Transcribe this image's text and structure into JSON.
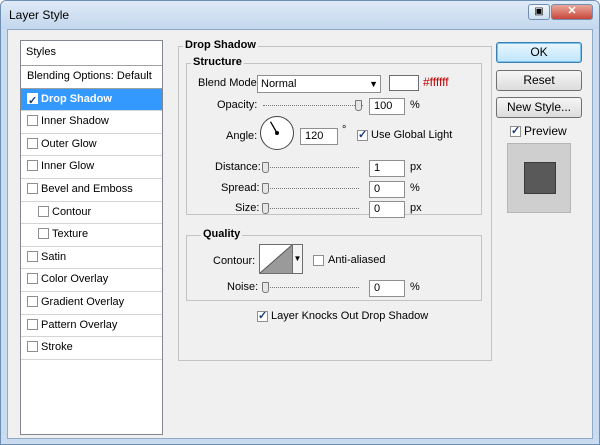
{
  "window": {
    "title": "Layer Style",
    "close_glyph": "✕"
  },
  "styles_panel": {
    "header": "Styles",
    "items": [
      {
        "label": "Blending Options: Default",
        "checkbox": false,
        "checked": false,
        "selected": false
      },
      {
        "label": "Drop Shadow",
        "checkbox": true,
        "checked": true,
        "selected": true
      },
      {
        "label": "Inner Shadow",
        "checkbox": true,
        "checked": false,
        "selected": false
      },
      {
        "label": "Outer Glow",
        "checkbox": true,
        "checked": false,
        "selected": false
      },
      {
        "label": "Inner Glow",
        "checkbox": true,
        "checked": false,
        "selected": false
      },
      {
        "label": "Bevel and Emboss",
        "checkbox": true,
        "checked": false,
        "selected": false
      },
      {
        "label": "Contour",
        "checkbox": true,
        "checked": false,
        "selected": false,
        "sub": true
      },
      {
        "label": "Texture",
        "checkbox": true,
        "checked": false,
        "selected": false,
        "sub": true
      },
      {
        "label": "Satin",
        "checkbox": true,
        "checked": false,
        "selected": false
      },
      {
        "label": "Color Overlay",
        "checkbox": true,
        "checked": false,
        "selected": false
      },
      {
        "label": "Gradient Overlay",
        "checkbox": true,
        "checked": false,
        "selected": false
      },
      {
        "label": "Pattern Overlay",
        "checkbox": true,
        "checked": false,
        "selected": false
      },
      {
        "label": "Stroke",
        "checkbox": true,
        "checked": false,
        "selected": false
      }
    ]
  },
  "drop_shadow": {
    "title": "Drop Shadow",
    "structure": {
      "title": "Structure",
      "blend_mode_label": "Blend Mode:",
      "blend_mode_value": "Normal",
      "color_hex": "#ffffff",
      "color": "#ffffff",
      "opacity_label": "Opacity:",
      "opacity_value": "100",
      "opacity_unit": "%",
      "opacity_fraction": 1.0,
      "angle_label": "Angle:",
      "angle_value": "120",
      "angle_degrees": 120,
      "angle_unit": "°",
      "use_global_light_label": "Use Global Light",
      "use_global_light": true,
      "distance_label": "Distance:",
      "distance_value": "1",
      "distance_unit": "px",
      "distance_fraction": 0.0,
      "spread_label": "Spread:",
      "spread_value": "0",
      "spread_unit": "%",
      "spread_fraction": 0.0,
      "size_label": "Size:",
      "size_value": "0",
      "size_unit": "px",
      "size_fraction": 0.0
    },
    "quality": {
      "title": "Quality",
      "contour_label": "Contour:",
      "anti_aliased_label": "Anti-aliased",
      "anti_aliased": false,
      "noise_label": "Noise:",
      "noise_value": "0",
      "noise_unit": "%",
      "noise_fraction": 0.0
    },
    "knockout_label": "Layer Knocks Out Drop Shadow",
    "knockout": true
  },
  "buttons": {
    "ok": "OK",
    "reset": "Reset",
    "new_style": "New Style..."
  },
  "preview": {
    "label": "Preview",
    "checked": true
  },
  "colors": {
    "selection": "#3399ff",
    "hex_text": "#c00000"
  }
}
